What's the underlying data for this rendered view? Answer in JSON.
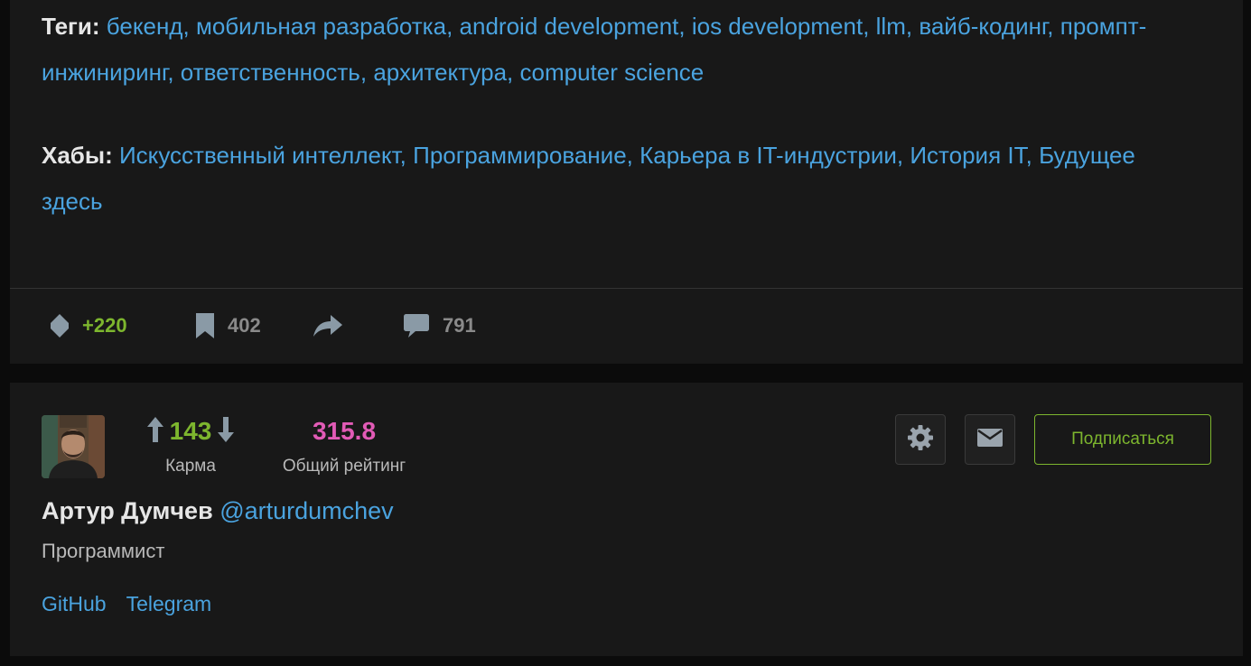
{
  "post": {
    "tags_label": "Теги:",
    "tags": [
      "бекенд",
      "мобильная разработка",
      "android development",
      "ios development",
      "llm",
      "вайб-кодинг",
      "промпт-инжиниринг",
      "ответственность",
      "архитектура",
      "computer science"
    ],
    "hubs_label": "Хабы:",
    "hubs": [
      "Искусственный интеллект",
      "Программирование",
      "Карьера в IT-индустрии",
      "История IT",
      "Будущее здесь"
    ],
    "stats": {
      "votes": "+220",
      "bookmarks": "402",
      "comments": "791"
    }
  },
  "author": {
    "karma": "143",
    "karma_label": "Карма",
    "rating": "315.8",
    "rating_label": "Общий рейтинг",
    "subscribe_label": "Подписаться",
    "name": "Артур Думчев",
    "handle": "@arturdumchev",
    "title": "Программист",
    "links": [
      "GitHub",
      "Telegram"
    ]
  },
  "colors": {
    "accent_green": "#7db62e",
    "link_blue": "#4aa3df",
    "rating_pink": "#e25bb6",
    "card_bg": "#181818"
  },
  "icons": [
    "votes-icon",
    "bookmark-icon",
    "share-icon",
    "comment-icon",
    "arrow-up-icon",
    "arrow-down-icon",
    "gear-icon",
    "mail-icon"
  ]
}
